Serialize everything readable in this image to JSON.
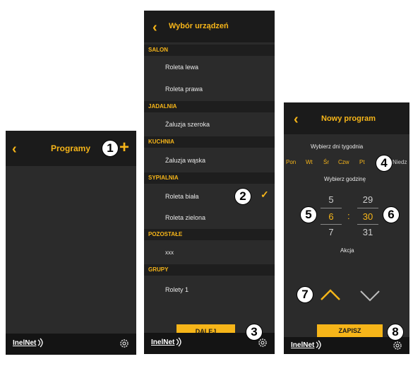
{
  "screen1": {
    "back_icon": "chevron-left-icon",
    "title": "Programy",
    "add_icon": "plus-icon",
    "callout": "1"
  },
  "screen2": {
    "title": "Wybór urządzeń",
    "sections": [
      {
        "name": "SALON",
        "items": [
          "Roleta lewa",
          "Roleta prawa"
        ]
      },
      {
        "name": "JADALNIA",
        "items": [
          "Żaluzja szeroka"
        ]
      },
      {
        "name": "KUCHNIA",
        "items": [
          "Żaluzja wąska"
        ]
      },
      {
        "name": "SYPIALNIA",
        "items": [
          "Roleta biała",
          "Roleta zielona"
        ]
      },
      {
        "name": "POZOSTAŁE",
        "items": [
          "xxx"
        ]
      },
      {
        "name": "GRUPY",
        "items": [
          "Rolety 1"
        ]
      }
    ],
    "selected_item": "Roleta biała",
    "next_button": "DALEJ",
    "callout_check": "2",
    "callout_next": "3"
  },
  "screen3": {
    "title": "Nowy program",
    "days_label": "Wybierz dni tygodnia",
    "days": [
      "Pon",
      "Wt",
      "Śr",
      "Czw",
      "Pt",
      "Niedz"
    ],
    "time_label": "Wybierz godzinę",
    "hours": [
      "5",
      "6",
      "7"
    ],
    "minutes": [
      "29",
      "30",
      "31"
    ],
    "separator": ":",
    "action_label": "Akcja",
    "save_button": "ZAPISZ",
    "callouts": [
      "4",
      "5",
      "6",
      "7",
      "8"
    ]
  },
  "footer": {
    "brand": "InelNet",
    "settings_icon": "gear-icon"
  },
  "colors": {
    "accent": "#f6b519",
    "background": "#2b2b2b",
    "header": "#1b1b1b"
  }
}
